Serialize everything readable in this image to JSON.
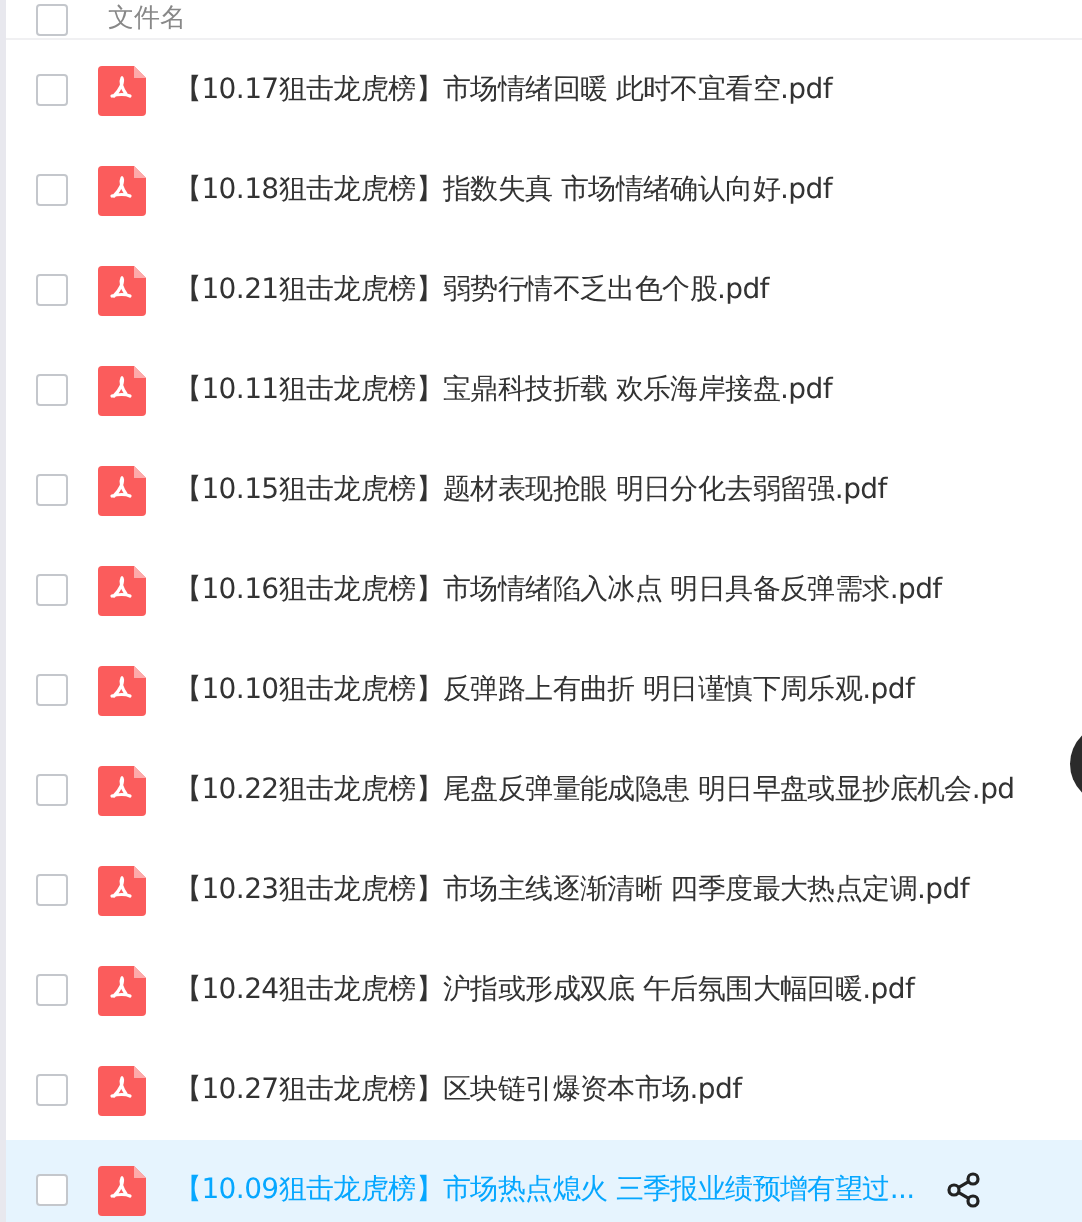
{
  "header": {
    "label": "文件名",
    "checked": false
  },
  "files": [
    {
      "name": "【10.17狙击龙虎榜】市场情绪回暖 此时不宜看空.pdf",
      "checked": false,
      "hovered": false
    },
    {
      "name": "【10.18狙击龙虎榜】指数失真 市场情绪确认向好.pdf",
      "checked": false,
      "hovered": false
    },
    {
      "name": "【10.21狙击龙虎榜】弱势行情不乏出色个股.pdf",
      "checked": false,
      "hovered": false
    },
    {
      "name": "【10.11狙击龙虎榜】宝鼎科技折载 欢乐海岸接盘.pdf",
      "checked": false,
      "hovered": false
    },
    {
      "name": "【10.15狙击龙虎榜】题材表现抢眼 明日分化去弱留强.pdf",
      "checked": false,
      "hovered": false
    },
    {
      "name": "【10.16狙击龙虎榜】市场情绪陷入冰点 明日具备反弹需求.pdf",
      "checked": false,
      "hovered": false
    },
    {
      "name": "【10.10狙击龙虎榜】反弹路上有曲折 明日谨慎下周乐观.pdf",
      "checked": false,
      "hovered": false
    },
    {
      "name": "【10.22狙击龙虎榜】尾盘反弹量能成隐患 明日早盘或显抄底机会.pd",
      "checked": false,
      "hovered": false
    },
    {
      "name": "【10.23狙击龙虎榜】市场主线逐渐清晰 四季度最大热点定调.pdf",
      "checked": false,
      "hovered": false
    },
    {
      "name": "【10.24狙击龙虎榜】沪指或形成双底 午后氛围大幅回暖.pdf",
      "checked": false,
      "hovered": false
    },
    {
      "name": "【10.27狙击龙虎榜】区块链引爆资本市场.pdf",
      "checked": false,
      "hovered": false
    },
    {
      "name": "【10.09狙击龙虎榜】市场热点熄火 三季报业绩预增有望过...",
      "checked": false,
      "hovered": true
    }
  ]
}
